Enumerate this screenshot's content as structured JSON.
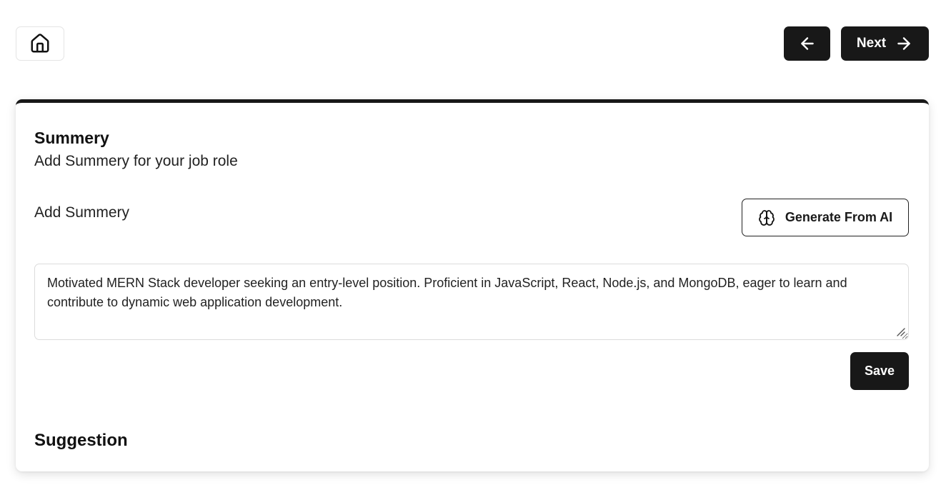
{
  "header": {
    "home_icon": "home-icon",
    "prev_icon": "arrow-left-icon",
    "next_label": "Next",
    "next_icon": "arrow-right-icon"
  },
  "summary": {
    "title": "Summery",
    "subtitle": "Add Summery for your job role",
    "field_label": "Add Summery",
    "ai_button_label": "Generate From AI",
    "ai_icon": "brain-icon",
    "text": "Motivated MERN Stack developer seeking an entry-level position. Proficient in JavaScript, React, Node.js, and MongoDB, eager to learn and contribute to dynamic web application development.",
    "save_label": "Save"
  },
  "suggestion": {
    "title": "Suggestion"
  },
  "colors": {
    "primary": "#181818",
    "background": "#ffffff",
    "border": "#dcdcdc"
  }
}
